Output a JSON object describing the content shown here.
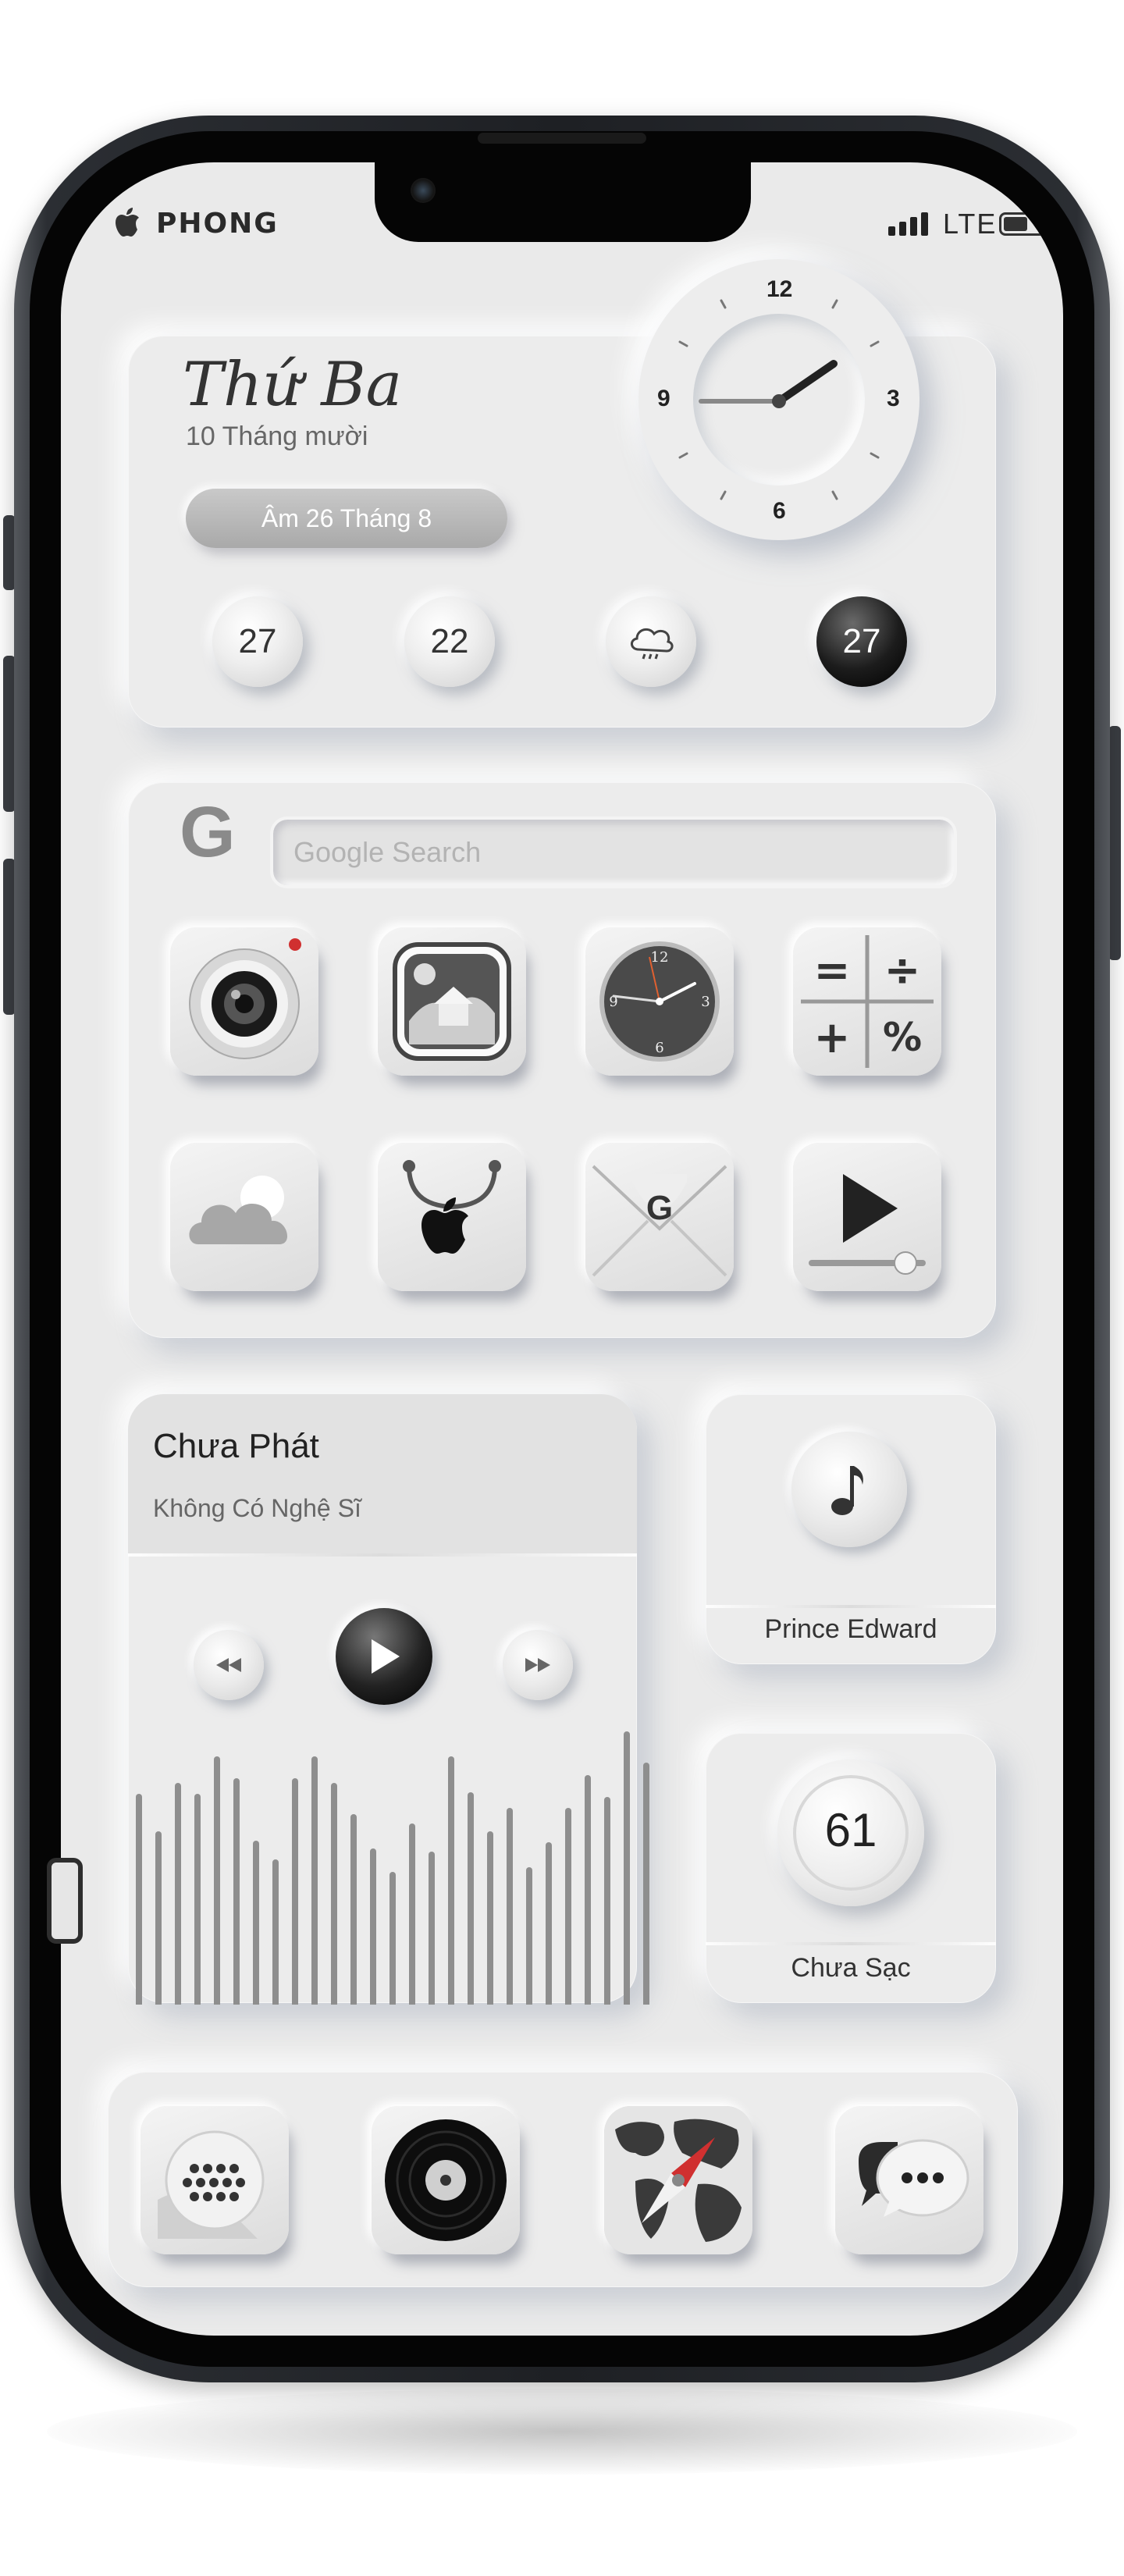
{
  "status_bar": {
    "carrier": "PHONG",
    "network": "LTE"
  },
  "date_widget": {
    "day_name": "Thứ Ba",
    "date": "10 Tháng mười",
    "lunar": "Âm 26 Tháng 8",
    "forecast": [
      "27",
      "22",
      "27"
    ],
    "clock_numbers": {
      "twelve": "12",
      "three": "3",
      "six": "6",
      "nine": "9"
    }
  },
  "search_widget": {
    "placeholder": "Google Search",
    "apps_row1": [
      "camera-app",
      "photos-app",
      "clock-app",
      "calculator-app"
    ],
    "apps_row2": [
      "weather-app",
      "app-store-app",
      "gmail-app",
      "video-app"
    ],
    "calc_symbols": [
      "=",
      "÷",
      "+",
      "%"
    ]
  },
  "music_widget": {
    "song": "Chưa Phát",
    "artist": "Không Có Nghệ Sĩ"
  },
  "music_note_widget": {
    "label": "Prince Edward"
  },
  "battery_widget": {
    "level": "61",
    "label": "Chưa Sạc"
  },
  "dock": {
    "apps": [
      "phone-app",
      "music-app",
      "safari-app",
      "messages-app"
    ]
  },
  "colors": {
    "background": "#eaeaea",
    "card": "#ececec",
    "accent_red": "#d03030"
  }
}
